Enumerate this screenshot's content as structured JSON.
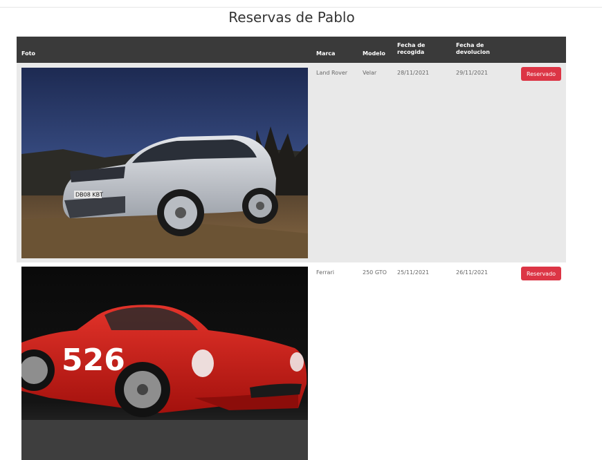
{
  "page": {
    "title": "Reservas de Pablo"
  },
  "table": {
    "headers": {
      "foto": "Foto",
      "marca": "Marca",
      "modelo": "Modelo",
      "recogida_1": "Fecha de",
      "recogida_2": "recogida",
      "devolucion_1": "Fecha de",
      "devolucion_2": "devolucion"
    },
    "rows": [
      {
        "marca": "Land Rover",
        "modelo": "Velar",
        "fecha_recogida": "28/11/2021",
        "fecha_devolucion": "29/11/2021",
        "estado": "Reservado",
        "plate": "DB08 KBT"
      },
      {
        "marca": "Ferrari",
        "modelo": "250 GTO",
        "fecha_recogida": "25/11/2021",
        "fecha_devolucion": "26/11/2021",
        "estado": "Reservado",
        "race_number": "526"
      }
    ]
  },
  "colors": {
    "header_bg": "#3a3a3a",
    "row_alt_bg": "#e9e9e9",
    "button_bg": "#dc3545",
    "button_text": "#ffffff"
  }
}
